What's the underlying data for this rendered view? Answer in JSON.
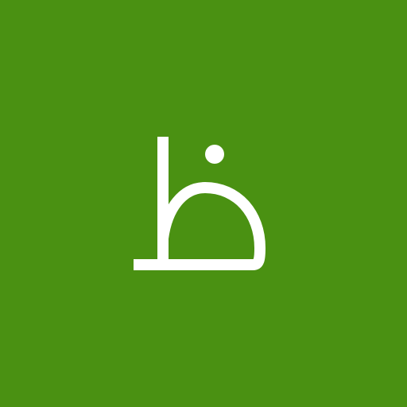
{
  "tile": {
    "letter": "ظ",
    "background_color": "#4a9112",
    "glyph_color": "#ffffff"
  }
}
